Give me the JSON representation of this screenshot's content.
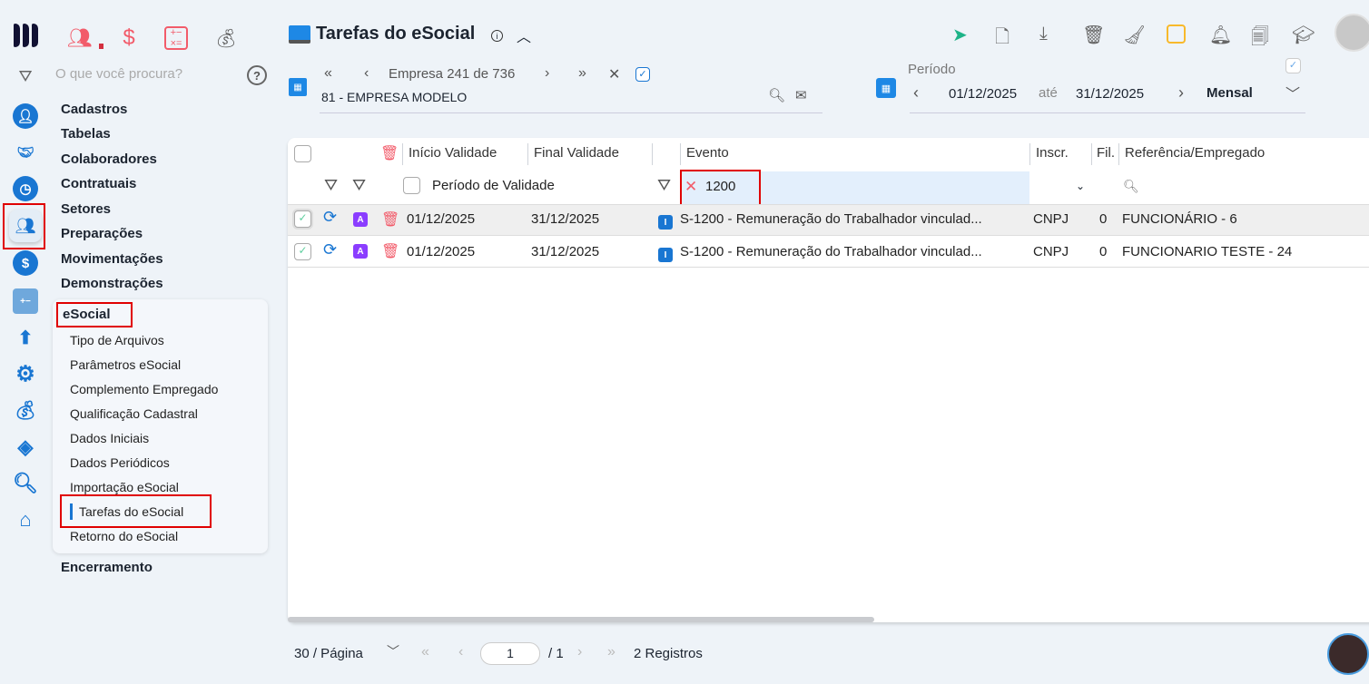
{
  "brand": {
    "logo": "M"
  },
  "top_modules": [
    {
      "icon": "people-icon"
    },
    {
      "icon": "dollar-icon"
    },
    {
      "icon": "calculator-icon"
    },
    {
      "icon": "money-bag-icon"
    }
  ],
  "search": {
    "placeholder": "O que você procura?"
  },
  "menu": [
    "Cadastros",
    "Tabelas",
    "Colaboradores",
    "Contratuais",
    "Setores",
    "Preparações",
    "Movimentações",
    "Demonstrações"
  ],
  "esocial": {
    "title": "eSocial",
    "items": [
      "Tipo de Arquivos",
      "Parâmetros eSocial",
      "Complemento Empregado",
      "Qualificação Cadastral",
      "Dados Iniciais",
      "Dados Periódicos",
      "Importação eSocial",
      "Tarefas do eSocial",
      "Retorno do eSocial"
    ],
    "active": "Tarefas do eSocial"
  },
  "menu_after": "Encerramento",
  "header": {
    "title": "Tarefas do eSocial",
    "empresa_label": "Empresa",
    "empresa_index": "241",
    "de": "de",
    "empresa_total": "736",
    "empresa_name": "81 - EMPRESA MODELO",
    "periodo_label": "Período",
    "date_from": "01/12/2025",
    "ate": "até",
    "date_to": "31/12/2025",
    "period_type": "Mensal"
  },
  "table": {
    "columns": [
      "Início Validade",
      "Final Validade",
      "Evento",
      "Inscr.",
      "Fil.",
      "Referência/Empregado"
    ],
    "filter": {
      "periodo_label": "Período de Validade",
      "evento_value": "1200"
    },
    "rows": [
      {
        "inicio": "01/12/2025",
        "final": "31/12/2025",
        "badge": "A",
        "tipo": "I",
        "evento": "S-1200 - Remuneração do Trabalhador vinculad...",
        "inscr": "CNPJ",
        "fil": "0",
        "ref": "FUNCIONÁRIO - 6"
      },
      {
        "inicio": "01/12/2025",
        "final": "31/12/2025",
        "badge": "A",
        "tipo": "I",
        "evento": "S-1200 - Remuneração do Trabalhador vinculad...",
        "inscr": "CNPJ",
        "fil": "0",
        "ref": "FUNCIONARIO TESTE - 24"
      }
    ]
  },
  "footer": {
    "per_page": "30 / Página",
    "page": "1",
    "total_pages": "/ 1",
    "records": "2 Registros"
  },
  "colors": {
    "accent": "#1976d2",
    "highlight": "#e00000",
    "badge": "#8b3dff"
  }
}
